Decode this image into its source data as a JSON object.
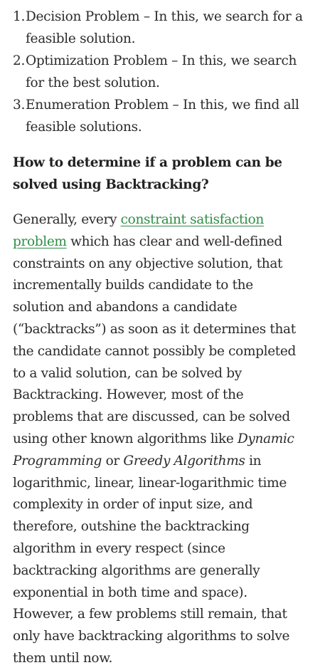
{
  "list": [
    {
      "num": "1.",
      "text": "Decision Problem – In this, we search for a feasible solution."
    },
    {
      "num": "2.",
      "text": "Optimization Problem – In this, we search for the best solution."
    },
    {
      "num": "3.",
      "text": "Enumeration Problem – In this, we find all feasible solutions."
    }
  ],
  "heading": "How to determine if a problem can be solved using Backtracking?",
  "paragraph": {
    "intro": "Generally, every ",
    "link_text": "constraint satisfaction problem",
    "part1": " which has clear and well-defined constraints on any objective solution, that incrementally builds candidate to the solution and abandons a candidate (“backtracks”) as soon as it determines that the candidate cannot possibly be completed to a valid solution, can be solved by Backtracking. However, most of the problems that are discussed, can be solved using other known algorithms like ",
    "em1": "Dynamic Programming",
    "part2": " or ",
    "em2": "Greedy Algorithms",
    "part3": " in logarithmic, linear, linear-logarithmic time complexity in order of input size, and therefore, outshine the backtracking algorithm in every respect (since backtracking algorithms are generally exponential in both time and space). However, a few problems still remain, that only have backtracking algorithms to solve them until now."
  },
  "colors": {
    "text": "#2b2b2b",
    "link": "#2f8d46",
    "background": "#ffffff"
  }
}
